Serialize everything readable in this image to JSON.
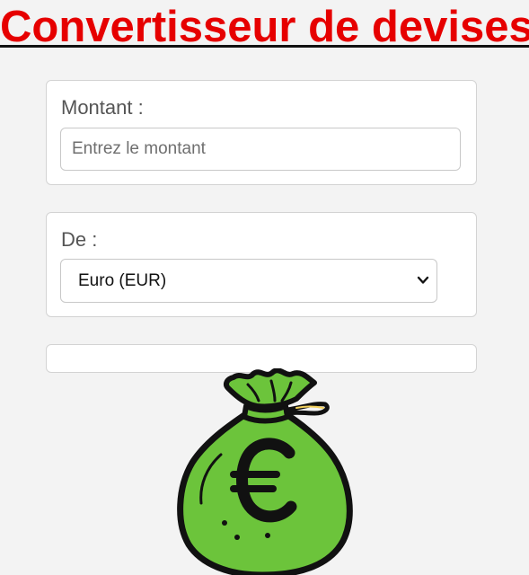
{
  "page": {
    "title": "Convertisseur de devises"
  },
  "amount": {
    "label": "Montant :",
    "value": "",
    "placeholder": "Entrez le montant"
  },
  "from": {
    "label": "De :",
    "selected": "Euro (EUR)"
  },
  "result": {
    "text": ""
  },
  "illustration": {
    "name": "money-bag-euro",
    "symbol": "€",
    "bag_color": "#6cc43b",
    "outline_color": "#111111"
  },
  "colors": {
    "title": "#e60000",
    "background": "#f3f3f3",
    "card": "#ffffff",
    "border": "#d3d3d3"
  }
}
